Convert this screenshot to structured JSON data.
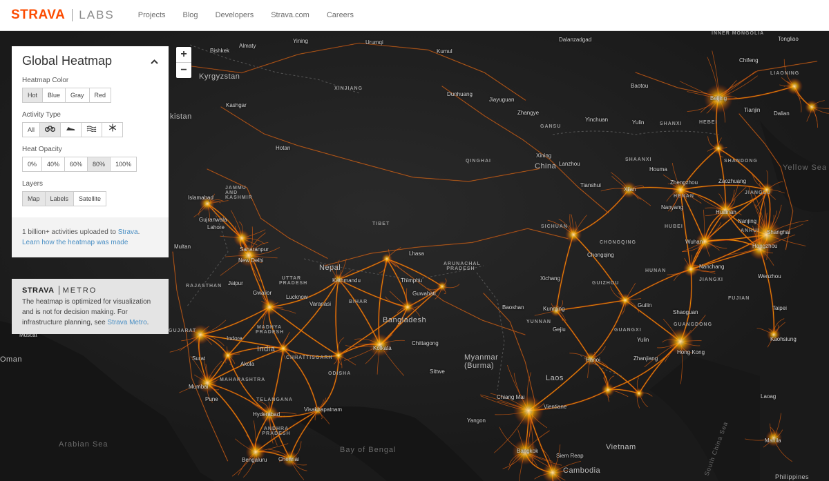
{
  "header": {
    "brand": "STRAVA",
    "sub_brand": "LABS",
    "nav": [
      "Projects",
      "Blog",
      "Developers",
      "Strava.com",
      "Careers"
    ]
  },
  "panel": {
    "title": "Global Heatmap",
    "collapse_icon": "chevron-up-icon",
    "heatmap_color": {
      "label": "Heatmap Color",
      "options": [
        "Hot",
        "Blue",
        "Gray",
        "Red"
      ],
      "selected": "Hot"
    },
    "activity_type": {
      "label": "Activity Type",
      "all": "All",
      "icons": [
        "bike-icon",
        "run-icon",
        "swim-icon",
        "winter-icon"
      ],
      "selected": "bike-icon"
    },
    "heat_opacity": {
      "label": "Heat Opacity",
      "options": [
        "0%",
        "40%",
        "60%",
        "80%",
        "100%"
      ],
      "selected": "80%"
    },
    "layers": {
      "label": "Layers",
      "options": [
        "Map",
        "Labels",
        "Satellite"
      ],
      "selected": [
        "Map",
        "Labels"
      ]
    },
    "footer_prefix": "1 billion+ activities uploaded to ",
    "footer_strava": "Strava",
    "footer_suffix": ".",
    "footer_link": "Learn how the heatmap was made"
  },
  "metro": {
    "brand": "STRAVA",
    "sub": "METRO",
    "text": "The heatmap is optimized for visualization and is not for decision making. For infrastructure planning, see ",
    "link": "Strava Metro",
    "suffix": "."
  },
  "zoom": {
    "in": "+",
    "out": "−"
  },
  "colors": {
    "brand": "#fc4c02",
    "link": "#4a8fc4",
    "heat_hot": "#ffb000",
    "heat_core": "#fff4c0",
    "map_bg": "#1c1c1c"
  },
  "map_labels": {
    "countries": [
      "Kyrgyzstan",
      "kistan",
      "China",
      "Nepal",
      "Bangladesh",
      "India",
      "Myanmar (Burma)",
      "Laos",
      "Oman",
      "Vietnam",
      "Cambodia",
      "Yellow Sea",
      "Arabian Sea",
      "Bay of Bengal",
      "South China Sea"
    ],
    "regions": [
      "INNER MONGOLIA",
      "XINJIANG",
      "GANSU",
      "QINGHAI",
      "SHAANXI",
      "SHANXI",
      "HEBEI",
      "SHANDONG",
      "HENAN",
      "JIANGSU",
      "ANHUI",
      "HUBEI",
      "SICHUAN",
      "CHONGQING",
      "TIBET",
      "HUNAN",
      "JIANGXI",
      "GUIZHOU",
      "FUJIAN",
      "YUNNAN",
      "GUANGXI",
      "GUANGDONG",
      "ARUNACHAL PRADESH",
      "UTTAR PRADESH",
      "BIHAR",
      "RAJASTHAN",
      "MADHYA PRADESH",
      "CHHATTISGARH",
      "ODISHA",
      "MAHARASHTRA",
      "TELANGANA",
      "ANDHRA PRADESH",
      "LIAONING",
      "GUJARAT",
      "JAMMU AND KASHMIR"
    ],
    "cities": [
      "Bishkek",
      "Almaty",
      "Yining",
      "Urumqi",
      "Kumul",
      "Dalanzadgad",
      "Tongliao",
      "Chifeng",
      "Beijing",
      "Dalian",
      "Tianjin",
      "Kashgar",
      "Hotan",
      "Dunhuang",
      "Jiayuguan",
      "Zhangye",
      "Yinchuan",
      "Baotou",
      "Yulin",
      "Xining",
      "Lanzhou",
      "Houma",
      "Zhengzhou",
      "Zaozhuang",
      "Xi'an",
      "Tianshui",
      "Nanyang",
      "Huainan",
      "Nanjing",
      "Shanghai",
      "Hangzhou",
      "Wenzhou",
      "Wuhan",
      "Nanchang",
      "Chongqing",
      "Xichang",
      "Baoshan",
      "Kunming",
      "Gejiu",
      "Guilin",
      "Shaoguan",
      "Hong Kong",
      "Yulin",
      "Zhanjiang",
      "Hanoi",
      "Taipei",
      "Kaohsiung",
      "Lhasa",
      "Kathmandu",
      "Thimphu",
      "Guwahati",
      "Varanasi",
      "Lucknow",
      "Kolkata",
      "Chittagong",
      "Sittwe",
      "Yangon",
      "Chiang Mai",
      "Vientiane",
      "Bangkok",
      "Siem Reap",
      "Islamabad",
      "Lahore",
      "Gujranwala",
      "Multan",
      "Saharanpur",
      "New Delhi",
      "Jaipur",
      "Gwalior",
      "Indore",
      "Surat",
      "Akola",
      "Mumbai",
      "Pune",
      "Hyderabad",
      "Visakhapatnam",
      "Bengaluru",
      "Chennai",
      "Muscat",
      "Laoag",
      "Manila",
      "Philippines"
    ]
  }
}
